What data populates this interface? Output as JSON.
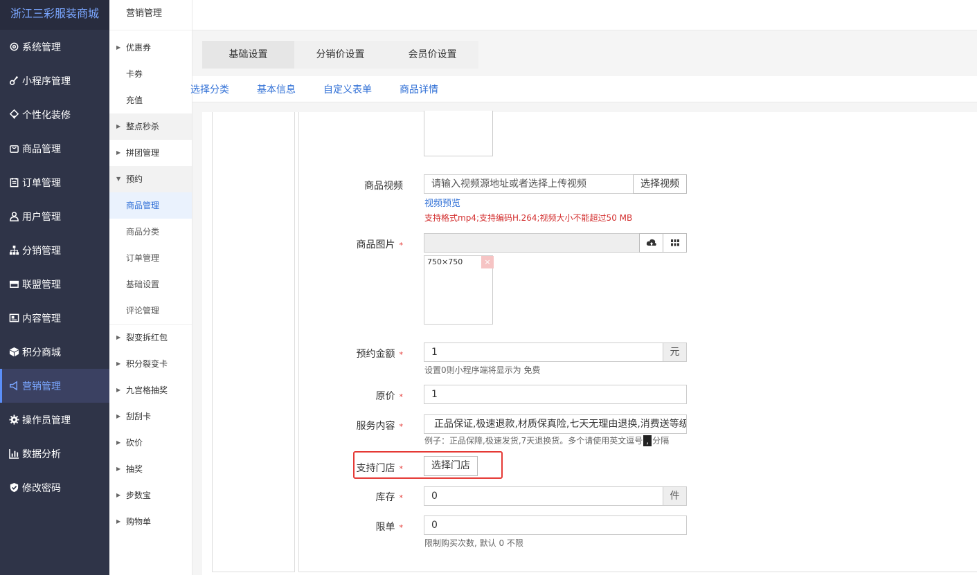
{
  "brand": "浙江三彩服装商城",
  "nav": [
    {
      "label": "系统管理",
      "icon": "gear-outline-icon"
    },
    {
      "label": "小程序管理",
      "icon": "link-icon"
    },
    {
      "label": "个性化装修",
      "icon": "decor-icon"
    },
    {
      "label": "商品管理",
      "icon": "bag-icon"
    },
    {
      "label": "订单管理",
      "icon": "clipboard-icon"
    },
    {
      "label": "用户管理",
      "icon": "user-icon"
    },
    {
      "label": "分销管理",
      "icon": "sitemap-icon"
    },
    {
      "label": "联盟管理",
      "icon": "store-icon"
    },
    {
      "label": "内容管理",
      "icon": "content-icon"
    },
    {
      "label": "积分商城",
      "icon": "cube-icon"
    },
    {
      "label": "营销管理",
      "icon": "megaphone-icon"
    },
    {
      "label": "操作员管理",
      "icon": "cog-icon"
    },
    {
      "label": "数据分析",
      "icon": "chart-icon"
    },
    {
      "label": "修改密码",
      "icon": "shield-icon"
    }
  ],
  "subnav": {
    "title": "营销管理",
    "items": [
      {
        "label": "优惠券"
      },
      {
        "label": "卡券"
      },
      {
        "label": "充值"
      },
      {
        "label": "整点秒杀"
      },
      {
        "label": "拼团管理"
      },
      {
        "label": "预约"
      },
      {
        "label": "商品管理"
      },
      {
        "label": "商品分类"
      },
      {
        "label": "订单管理"
      },
      {
        "label": "基础设置"
      },
      {
        "label": "评论管理"
      },
      {
        "label": "裂变拆红包"
      },
      {
        "label": "积分裂变卡"
      },
      {
        "label": "九宫格抽奖"
      },
      {
        "label": "刮刮卡"
      },
      {
        "label": "砍价"
      },
      {
        "label": "抽奖"
      },
      {
        "label": "步数宝"
      },
      {
        "label": "购物单"
      }
    ]
  },
  "tabs": [
    "基础设置",
    "分销价设置",
    "会员价设置"
  ],
  "steps": [
    "选择分类",
    "基本信息",
    "自定义表单",
    "商品详情"
  ],
  "form": {
    "video": {
      "label": "商品视频",
      "placeholder": "请输入视频源地址或者选择上传视频",
      "button": "选择视频",
      "preview": "视频预览",
      "hint": "支持格式mp4;支持编码H.264;视频大小不能超过50 MB"
    },
    "image": {
      "label": "商品图片",
      "required": "*",
      "size": "750×750",
      "remove": "×"
    },
    "amount": {
      "label": "预约金额",
      "required": "*",
      "value": "1",
      "unit": "元",
      "hint": "设置0则小程序端将显示为 免费"
    },
    "original_price": {
      "label": "原价",
      "required": "*",
      "value": "1"
    },
    "service": {
      "label": "服务内容",
      "required": "*",
      "value": "正品保证,极速退款,材质保真险,七天无理由退换,消费送等级",
      "hint_before": "例子：正品保障,极速发货,7天退换货。多个请使用英文逗号",
      "hint_mark": ",",
      "hint_after": "分隔"
    },
    "store": {
      "label": "支持门店",
      "required": "*",
      "button": "选择门店"
    },
    "stock": {
      "label": "库存",
      "required": "*",
      "value": "0",
      "unit": "件"
    },
    "limit": {
      "label": "限单",
      "required": "*",
      "value": "0",
      "hint": "限制购买次数, 默认 0 不限"
    }
  },
  "colors": {
    "sidebar": "#2f3448",
    "accent": "#2f6fd6",
    "highlight_box": "#e53935",
    "required": "#e53935"
  }
}
